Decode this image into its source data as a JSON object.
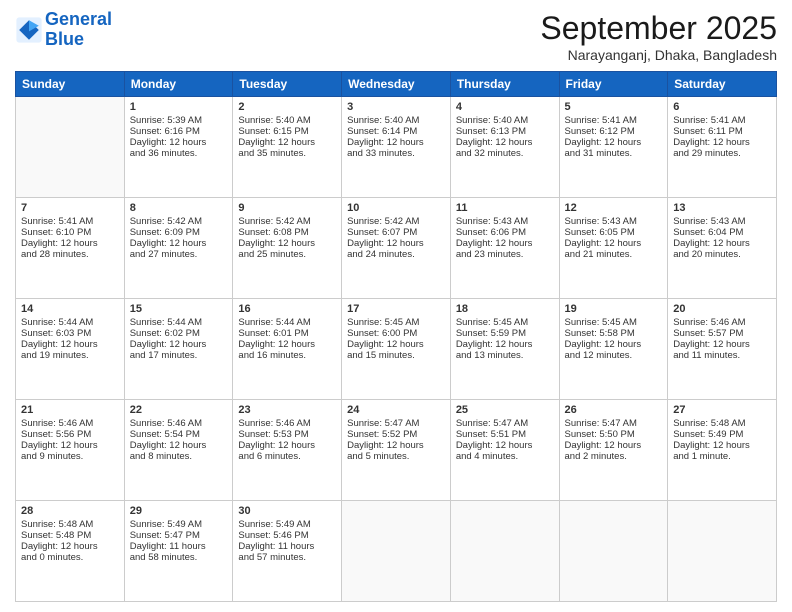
{
  "header": {
    "logo_line1": "General",
    "logo_line2": "Blue",
    "month_title": "September 2025",
    "location": "Narayanganj, Dhaka, Bangladesh"
  },
  "days_of_week": [
    "Sunday",
    "Monday",
    "Tuesday",
    "Wednesday",
    "Thursday",
    "Friday",
    "Saturday"
  ],
  "weeks": [
    [
      {
        "day": "",
        "info": ""
      },
      {
        "day": "1",
        "info": "Sunrise: 5:39 AM\nSunset: 6:16 PM\nDaylight: 12 hours\nand 36 minutes."
      },
      {
        "day": "2",
        "info": "Sunrise: 5:40 AM\nSunset: 6:15 PM\nDaylight: 12 hours\nand 35 minutes."
      },
      {
        "day": "3",
        "info": "Sunrise: 5:40 AM\nSunset: 6:14 PM\nDaylight: 12 hours\nand 33 minutes."
      },
      {
        "day": "4",
        "info": "Sunrise: 5:40 AM\nSunset: 6:13 PM\nDaylight: 12 hours\nand 32 minutes."
      },
      {
        "day": "5",
        "info": "Sunrise: 5:41 AM\nSunset: 6:12 PM\nDaylight: 12 hours\nand 31 minutes."
      },
      {
        "day": "6",
        "info": "Sunrise: 5:41 AM\nSunset: 6:11 PM\nDaylight: 12 hours\nand 29 minutes."
      }
    ],
    [
      {
        "day": "7",
        "info": "Sunrise: 5:41 AM\nSunset: 6:10 PM\nDaylight: 12 hours\nand 28 minutes."
      },
      {
        "day": "8",
        "info": "Sunrise: 5:42 AM\nSunset: 6:09 PM\nDaylight: 12 hours\nand 27 minutes."
      },
      {
        "day": "9",
        "info": "Sunrise: 5:42 AM\nSunset: 6:08 PM\nDaylight: 12 hours\nand 25 minutes."
      },
      {
        "day": "10",
        "info": "Sunrise: 5:42 AM\nSunset: 6:07 PM\nDaylight: 12 hours\nand 24 minutes."
      },
      {
        "day": "11",
        "info": "Sunrise: 5:43 AM\nSunset: 6:06 PM\nDaylight: 12 hours\nand 23 minutes."
      },
      {
        "day": "12",
        "info": "Sunrise: 5:43 AM\nSunset: 6:05 PM\nDaylight: 12 hours\nand 21 minutes."
      },
      {
        "day": "13",
        "info": "Sunrise: 5:43 AM\nSunset: 6:04 PM\nDaylight: 12 hours\nand 20 minutes."
      }
    ],
    [
      {
        "day": "14",
        "info": "Sunrise: 5:44 AM\nSunset: 6:03 PM\nDaylight: 12 hours\nand 19 minutes."
      },
      {
        "day": "15",
        "info": "Sunrise: 5:44 AM\nSunset: 6:02 PM\nDaylight: 12 hours\nand 17 minutes."
      },
      {
        "day": "16",
        "info": "Sunrise: 5:44 AM\nSunset: 6:01 PM\nDaylight: 12 hours\nand 16 minutes."
      },
      {
        "day": "17",
        "info": "Sunrise: 5:45 AM\nSunset: 6:00 PM\nDaylight: 12 hours\nand 15 minutes."
      },
      {
        "day": "18",
        "info": "Sunrise: 5:45 AM\nSunset: 5:59 PM\nDaylight: 12 hours\nand 13 minutes."
      },
      {
        "day": "19",
        "info": "Sunrise: 5:45 AM\nSunset: 5:58 PM\nDaylight: 12 hours\nand 12 minutes."
      },
      {
        "day": "20",
        "info": "Sunrise: 5:46 AM\nSunset: 5:57 PM\nDaylight: 12 hours\nand 11 minutes."
      }
    ],
    [
      {
        "day": "21",
        "info": "Sunrise: 5:46 AM\nSunset: 5:56 PM\nDaylight: 12 hours\nand 9 minutes."
      },
      {
        "day": "22",
        "info": "Sunrise: 5:46 AM\nSunset: 5:54 PM\nDaylight: 12 hours\nand 8 minutes."
      },
      {
        "day": "23",
        "info": "Sunrise: 5:46 AM\nSunset: 5:53 PM\nDaylight: 12 hours\nand 6 minutes."
      },
      {
        "day": "24",
        "info": "Sunrise: 5:47 AM\nSunset: 5:52 PM\nDaylight: 12 hours\nand 5 minutes."
      },
      {
        "day": "25",
        "info": "Sunrise: 5:47 AM\nSunset: 5:51 PM\nDaylight: 12 hours\nand 4 minutes."
      },
      {
        "day": "26",
        "info": "Sunrise: 5:47 AM\nSunset: 5:50 PM\nDaylight: 12 hours\nand 2 minutes."
      },
      {
        "day": "27",
        "info": "Sunrise: 5:48 AM\nSunset: 5:49 PM\nDaylight: 12 hours\nand 1 minute."
      }
    ],
    [
      {
        "day": "28",
        "info": "Sunrise: 5:48 AM\nSunset: 5:48 PM\nDaylight: 12 hours\nand 0 minutes."
      },
      {
        "day": "29",
        "info": "Sunrise: 5:49 AM\nSunset: 5:47 PM\nDaylight: 11 hours\nand 58 minutes."
      },
      {
        "day": "30",
        "info": "Sunrise: 5:49 AM\nSunset: 5:46 PM\nDaylight: 11 hours\nand 57 minutes."
      },
      {
        "day": "",
        "info": ""
      },
      {
        "day": "",
        "info": ""
      },
      {
        "day": "",
        "info": ""
      },
      {
        "day": "",
        "info": ""
      }
    ]
  ]
}
